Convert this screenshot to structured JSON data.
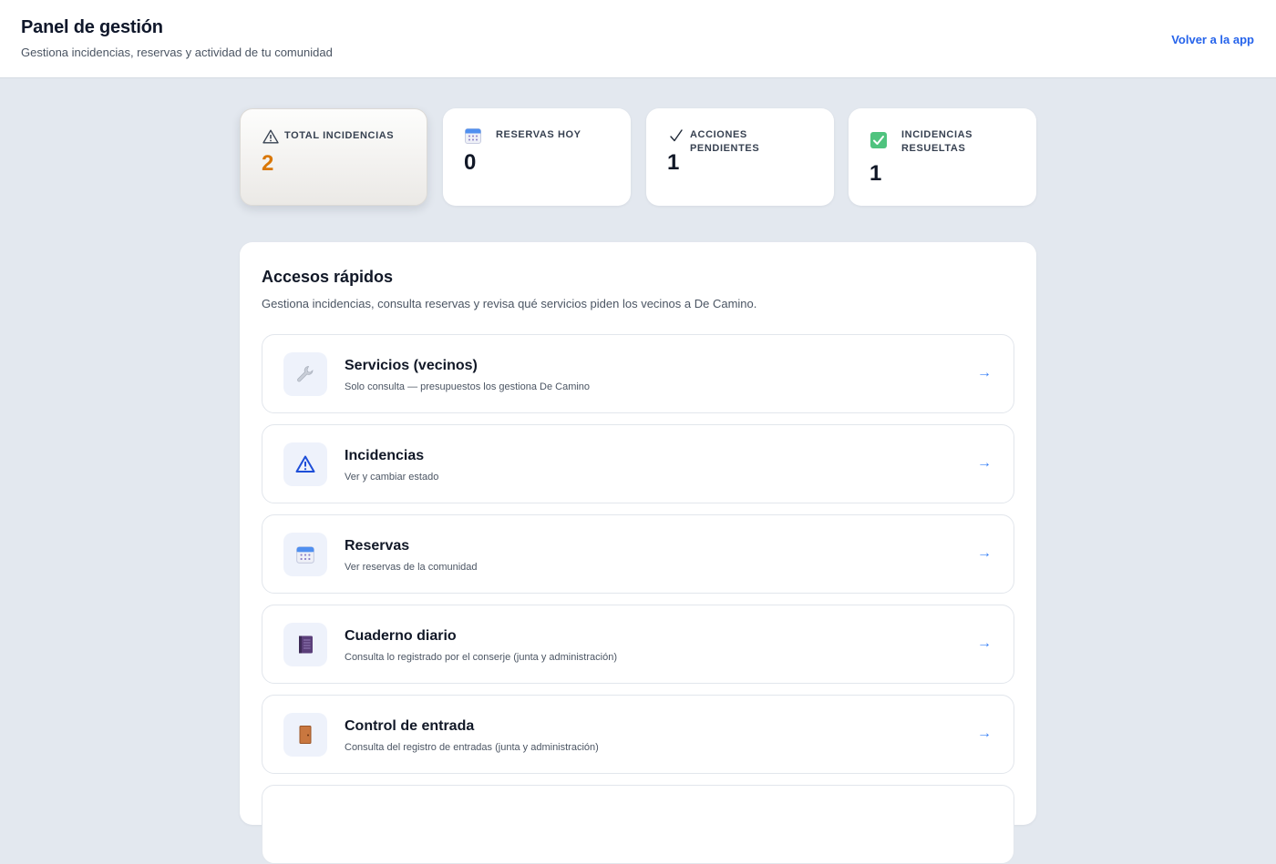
{
  "header": {
    "title": "Panel de gestión",
    "subtitle": "Gestiona incidencias, reservas y actividad de tu comunidad",
    "back_link": "Volver a la app"
  },
  "stats": [
    {
      "label": "TOTAL INCIDENCIAS",
      "value": "2",
      "icon": "warning-icon",
      "active": true
    },
    {
      "label": "RESERVAS HOY",
      "value": "0",
      "icon": "calendar-icon"
    },
    {
      "label": "ACCIONES PENDIENTES",
      "value": "1",
      "icon": "checkmark-icon"
    },
    {
      "label": "INCIDENCIAS RESUELTAS",
      "value": "1",
      "icon": "check-box-icon"
    }
  ],
  "quick_access": {
    "title": "Accesos rápidos",
    "description": "Gestiona incidencias, consulta reservas y revisa qué servicios piden los vecinos a De Camino.",
    "items": [
      {
        "title": "Servicios (vecinos)",
        "subtitle": "Solo consulta — presupuestos los gestiona De Camino",
        "icon": "wrench-icon",
        "arrow": "→"
      },
      {
        "title": "Incidencias",
        "subtitle": "Ver y cambiar estado",
        "icon": "warning-icon",
        "arrow": "→"
      },
      {
        "title": "Reservas",
        "subtitle": "Ver reservas de la comunidad",
        "icon": "calendar-icon",
        "arrow": "→"
      },
      {
        "title": "Cuaderno diario",
        "subtitle": "Consulta lo registrado por el conserje (junta y administración)",
        "icon": "notebook-icon",
        "arrow": "→"
      },
      {
        "title": "Control de entrada",
        "subtitle": "Consulta del registro de entradas (junta y administración)",
        "icon": "door-icon",
        "arrow": "→"
      }
    ]
  },
  "colors": {
    "accent": "#2563eb",
    "highlight_value": "#d97706",
    "background": "#e3e8ef"
  }
}
